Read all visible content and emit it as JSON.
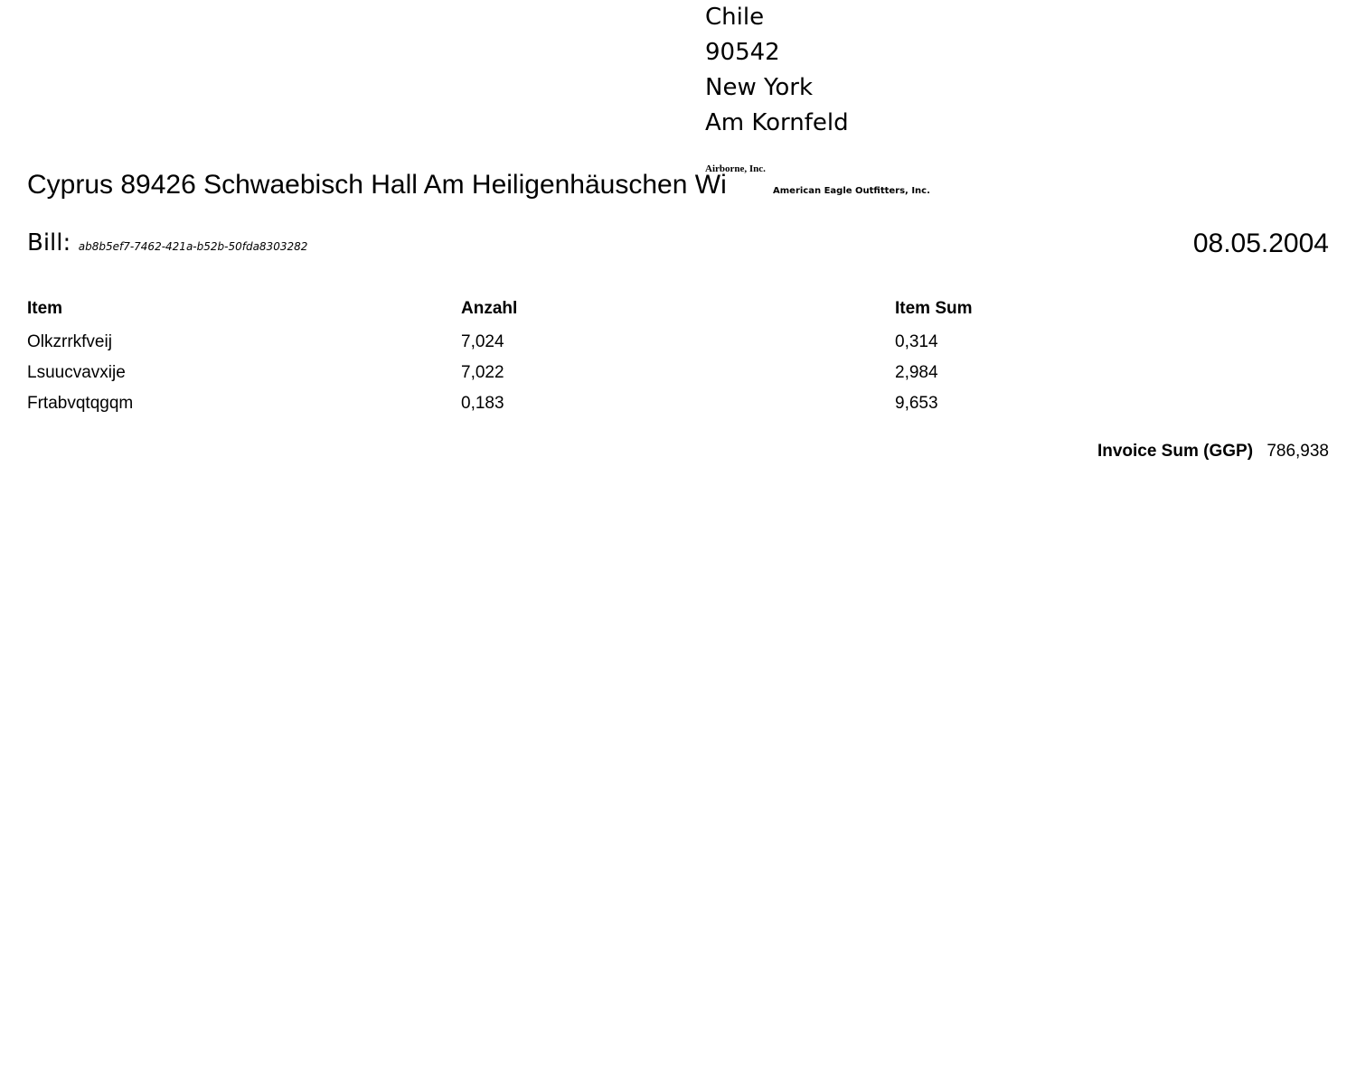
{
  "recipient": {
    "country": "Chile",
    "zip": "90542",
    "city": "New York",
    "street": "Am Kornfeld"
  },
  "companies": {
    "first": "Airborne, Inc.",
    "second": "American Eagle Outfitters, Inc."
  },
  "sender_line": "Cyprus 89426 Schwaebisch Hall Am Heiligenhäuschen Wi",
  "bill": {
    "label": "Bill:",
    "number": "ab8b5ef7-7462-421a-b52b-50fda8303282",
    "date": "08.05.2004"
  },
  "table": {
    "headers": [
      "Item",
      "Anzahl",
      "Item Sum"
    ],
    "rows": [
      [
        "Olkzrrkfveij",
        "7,024",
        "0,314"
      ],
      [
        "Lsuucvavxije",
        "7,022",
        "2,984"
      ],
      [
        "Frtabvqtqgqm",
        "0,183",
        "9,653"
      ]
    ]
  },
  "total": {
    "label": "Invoice Sum (GGP)",
    "value": "786,938"
  }
}
